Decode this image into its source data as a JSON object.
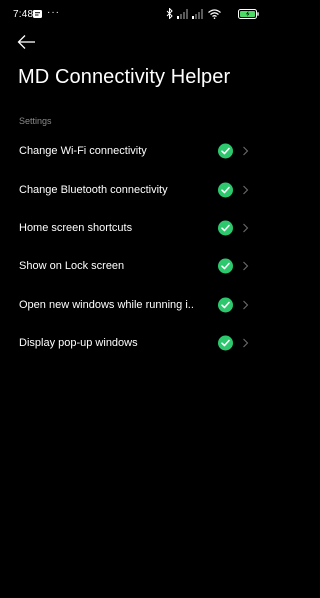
{
  "status_bar": {
    "time": "7:48",
    "more": "···",
    "battery_color": "#4cd964",
    "icons": [
      "notification-icon",
      "bluetooth-icon",
      "signal-icon",
      "signal-icon",
      "wifi-icon",
      "battery-icon"
    ]
  },
  "header": {
    "back_icon": "arrow-left-icon",
    "title": "MD Connectivity Helper"
  },
  "settings": {
    "section_label": "Settings",
    "items": [
      {
        "label": "Change Wi-Fi connectivity",
        "status_icon": "check-circle-icon",
        "trailing_icon": "chevron-right-icon"
      },
      {
        "label": "Change Bluetooth connectivity",
        "status_icon": "check-circle-icon",
        "trailing_icon": "chevron-right-icon"
      },
      {
        "label": "Home screen shortcuts",
        "status_icon": "check-circle-icon",
        "trailing_icon": "chevron-right-icon"
      },
      {
        "label": "Show on Lock screen",
        "status_icon": "check-circle-icon",
        "trailing_icon": "chevron-right-icon"
      },
      {
        "label": "Open new windows while running i..",
        "status_icon": "check-circle-icon",
        "trailing_icon": "chevron-right-icon"
      },
      {
        "label": "Display pop-up windows",
        "status_icon": "check-circle-icon",
        "trailing_icon": "chevron-right-icon"
      }
    ]
  },
  "colors": {
    "background": "#000000",
    "accent_green": "#2dc86e",
    "secondary_text": "#8a8a8a",
    "chevron": "#6b6b6b"
  }
}
